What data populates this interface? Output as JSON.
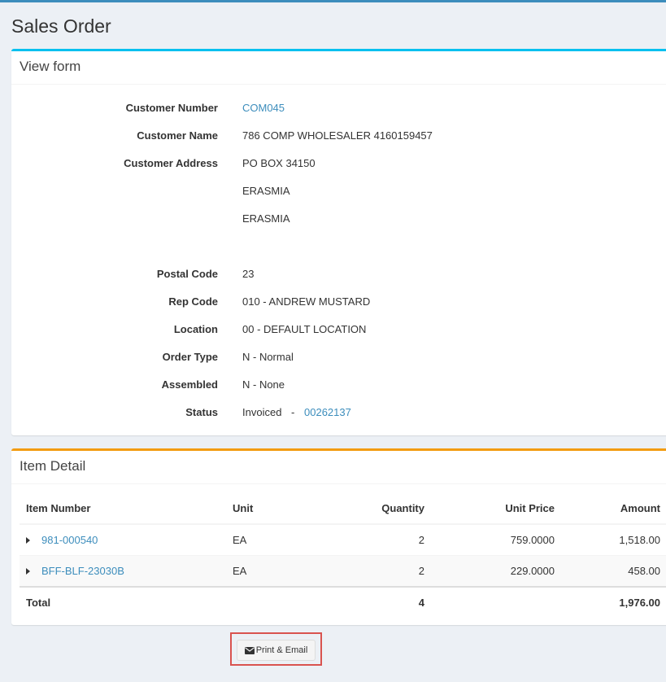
{
  "page": {
    "title": "Sales Order"
  },
  "view_form": {
    "title": "View form",
    "customer_number_label": "Customer Number",
    "customer_number": "COM045",
    "customer_name_label": "Customer Name",
    "customer_name": "786 COMP WHOLESALER 4160159457",
    "customer_address_label": "Customer Address",
    "address_line_1": "PO BOX 34150",
    "address_line_2": "ERASMIA",
    "address_line_3": "ERASMIA",
    "postal_code_label": "Postal Code",
    "postal_code": "23",
    "rep_code_label": "Rep Code",
    "rep_code": "010 - ANDREW MUSTARD",
    "location_label": "Location",
    "location": "00 - DEFAULT LOCATION",
    "order_type_label": "Order Type",
    "order_type": "N - Normal",
    "assembled_label": "Assembled",
    "assembled": "N - None",
    "status_label": "Status",
    "status_text": "Invoiced",
    "status_separator": "-",
    "status_invoice": "00262137"
  },
  "item_detail": {
    "title": "Item Detail",
    "columns": {
      "item_number": "Item Number",
      "unit": "Unit",
      "quantity": "Quantity",
      "unit_price": "Unit Price",
      "amount": "Amount"
    },
    "rows": [
      {
        "item_number": "981-000540",
        "unit": "EA",
        "quantity": "2",
        "unit_price": "759.0000",
        "amount": "1,518.00"
      },
      {
        "item_number": "BFF-BLF-23030B",
        "unit": "EA",
        "quantity": "2",
        "unit_price": "229.0000",
        "amount": "458.00"
      }
    ],
    "total": {
      "label": "Total",
      "quantity": "4",
      "amount": "1,976.00"
    }
  },
  "actions": {
    "print_email_label": "Print & Email",
    "icon": "envelope-icon"
  },
  "colors": {
    "accent": "#3c8dbc",
    "info_box": "#00c0ef",
    "warning_box": "#f39c12",
    "highlight": "#d9534f"
  }
}
